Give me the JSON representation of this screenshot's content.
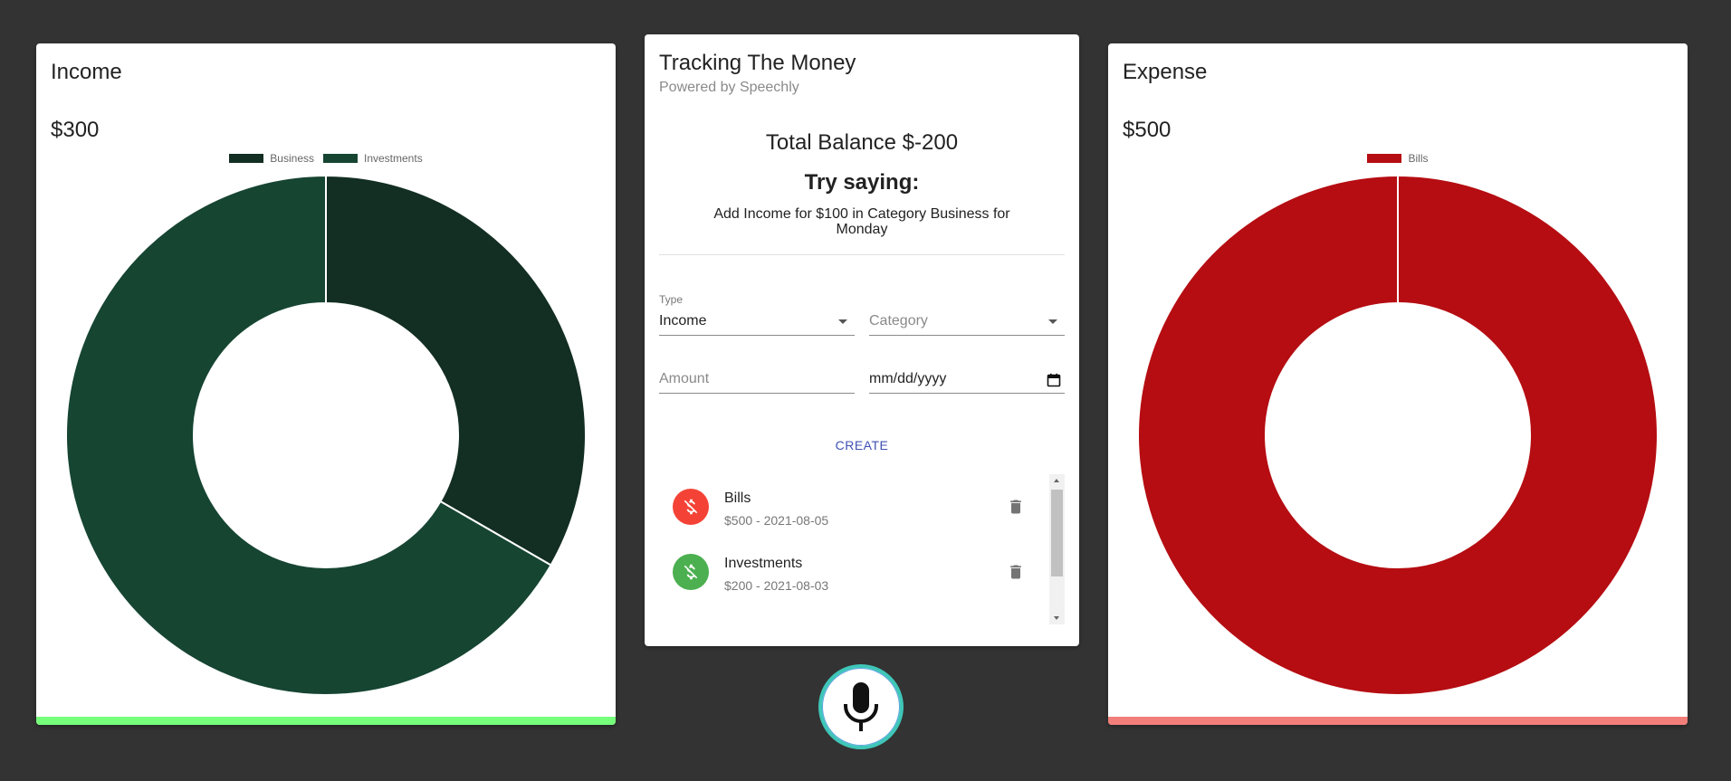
{
  "income": {
    "title": "Income",
    "amount": "$300",
    "accent": "#76ff7a",
    "legend": [
      {
        "label": "Business",
        "color": "#132e22"
      },
      {
        "label": "Investments",
        "color": "#164532"
      }
    ]
  },
  "expense": {
    "title": "Expense",
    "amount": "$500",
    "accent": "#f27e7a",
    "legend": [
      {
        "label": "Bills",
        "color": "#b50d12"
      }
    ]
  },
  "main": {
    "title": "Tracking The Money",
    "subtitle": "Powered by Speechly",
    "balance": "Total Balance $-200",
    "try_saying": "Try saying:",
    "hint": "Add Income for $100 in Category Business for Monday",
    "form": {
      "type_label": "Type",
      "type_value": "Income",
      "category_placeholder": "Category",
      "amount_placeholder": "Amount",
      "date_placeholder": "mm/dd/yyyy",
      "create_label": "CREATE"
    },
    "transactions": [
      {
        "name": "Bills",
        "detail": "$500 - 2021-08-05",
        "icon": "money-off-icon",
        "color": "#f44336"
      },
      {
        "name": "Investments",
        "detail": "$200 - 2021-08-03",
        "icon": "money-off-icon",
        "color": "#4caf50"
      }
    ]
  },
  "mic": {
    "icon": "microphone-icon"
  },
  "chart_data": [
    {
      "type": "pie",
      "variant": "doughnut",
      "title": "Income",
      "categories": [
        "Business",
        "Investments"
      ],
      "values": [
        100,
        200
      ],
      "colors": [
        "#132e22",
        "#164532"
      ],
      "legend": "top"
    },
    {
      "type": "pie",
      "variant": "doughnut",
      "title": "Expense",
      "categories": [
        "Bills"
      ],
      "values": [
        500
      ],
      "colors": [
        "#b50d12"
      ],
      "legend": "top"
    }
  ]
}
